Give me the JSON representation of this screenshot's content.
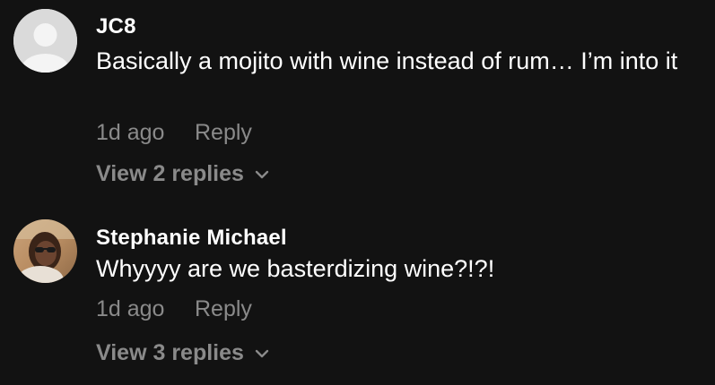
{
  "comments": [
    {
      "username": "JC8",
      "text": "Basically a mojito with wine instead of rum… I’m into it",
      "time": "1d ago",
      "reply_label": "Reply",
      "view_replies": "View 2 replies",
      "avatar_icon": "default-user-icon"
    },
    {
      "username": "Stephanie Michael",
      "text": "Whyyyy are we basterdizing wine?!?!",
      "time": "1d ago",
      "reply_label": "Reply",
      "view_replies": "View 3 replies",
      "avatar_icon": "profile-photo"
    }
  ],
  "colors": {
    "background": "#121212",
    "primary_text": "#ffffff",
    "secondary_text": "#8a8a8a"
  }
}
